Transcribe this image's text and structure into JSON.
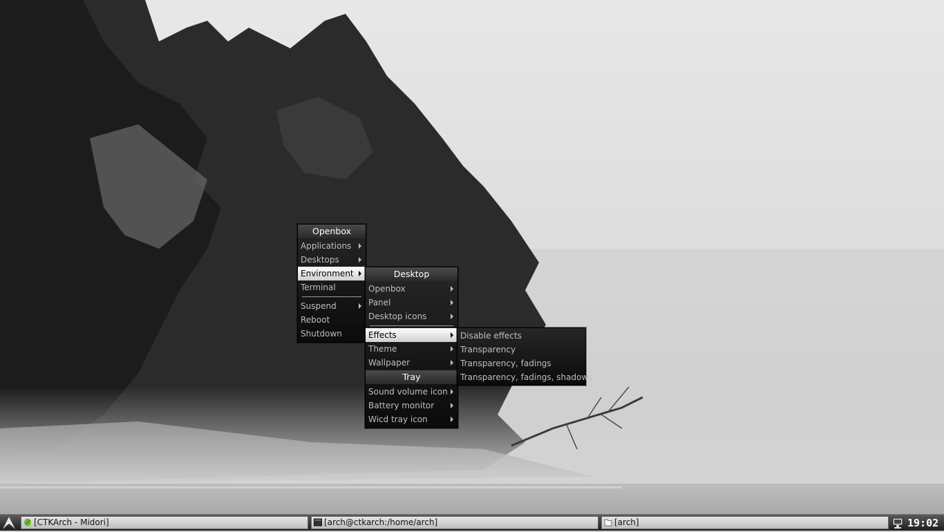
{
  "root_menu": {
    "title": "Openbox",
    "items": [
      {
        "label": "Applications",
        "submenu": true
      },
      {
        "label": "Desktops",
        "submenu": true
      },
      {
        "label": "Environment",
        "submenu": true,
        "active": true
      },
      {
        "label": "Terminal",
        "submenu": false
      }
    ],
    "items2": [
      {
        "label": "Suspend",
        "submenu": true
      },
      {
        "label": "Reboot",
        "submenu": false
      },
      {
        "label": "Shutdown",
        "submenu": false
      }
    ]
  },
  "environment_menu": {
    "title": "Desktop",
    "items": [
      {
        "label": "Openbox"
      },
      {
        "label": "Panel"
      },
      {
        "label": "Desktop icons"
      }
    ],
    "items2": [
      {
        "label": "Effects",
        "active": true
      },
      {
        "label": "Theme"
      },
      {
        "label": "Wallpaper"
      }
    ],
    "tray_title": "Tray",
    "tray_items": [
      {
        "label": "Sound volume icon"
      },
      {
        "label": "Battery monitor"
      },
      {
        "label": "Wicd tray icon"
      }
    ]
  },
  "effects_menu": {
    "items": [
      {
        "label": "Disable effects"
      },
      {
        "label": "Transparency"
      },
      {
        "label": "Transparency, fadings"
      },
      {
        "label": "Transparency, fadings, shadows"
      }
    ]
  },
  "taskbar": {
    "tasks": [
      {
        "label": "[CTKArch - Midori]",
        "icon": "midori-leaf-icon"
      },
      {
        "label": "[arch@ctkarch:/home/arch]",
        "icon": "terminal-icon"
      },
      {
        "label": "[arch]",
        "icon": "folder-icon"
      }
    ],
    "clock": "19:02"
  }
}
